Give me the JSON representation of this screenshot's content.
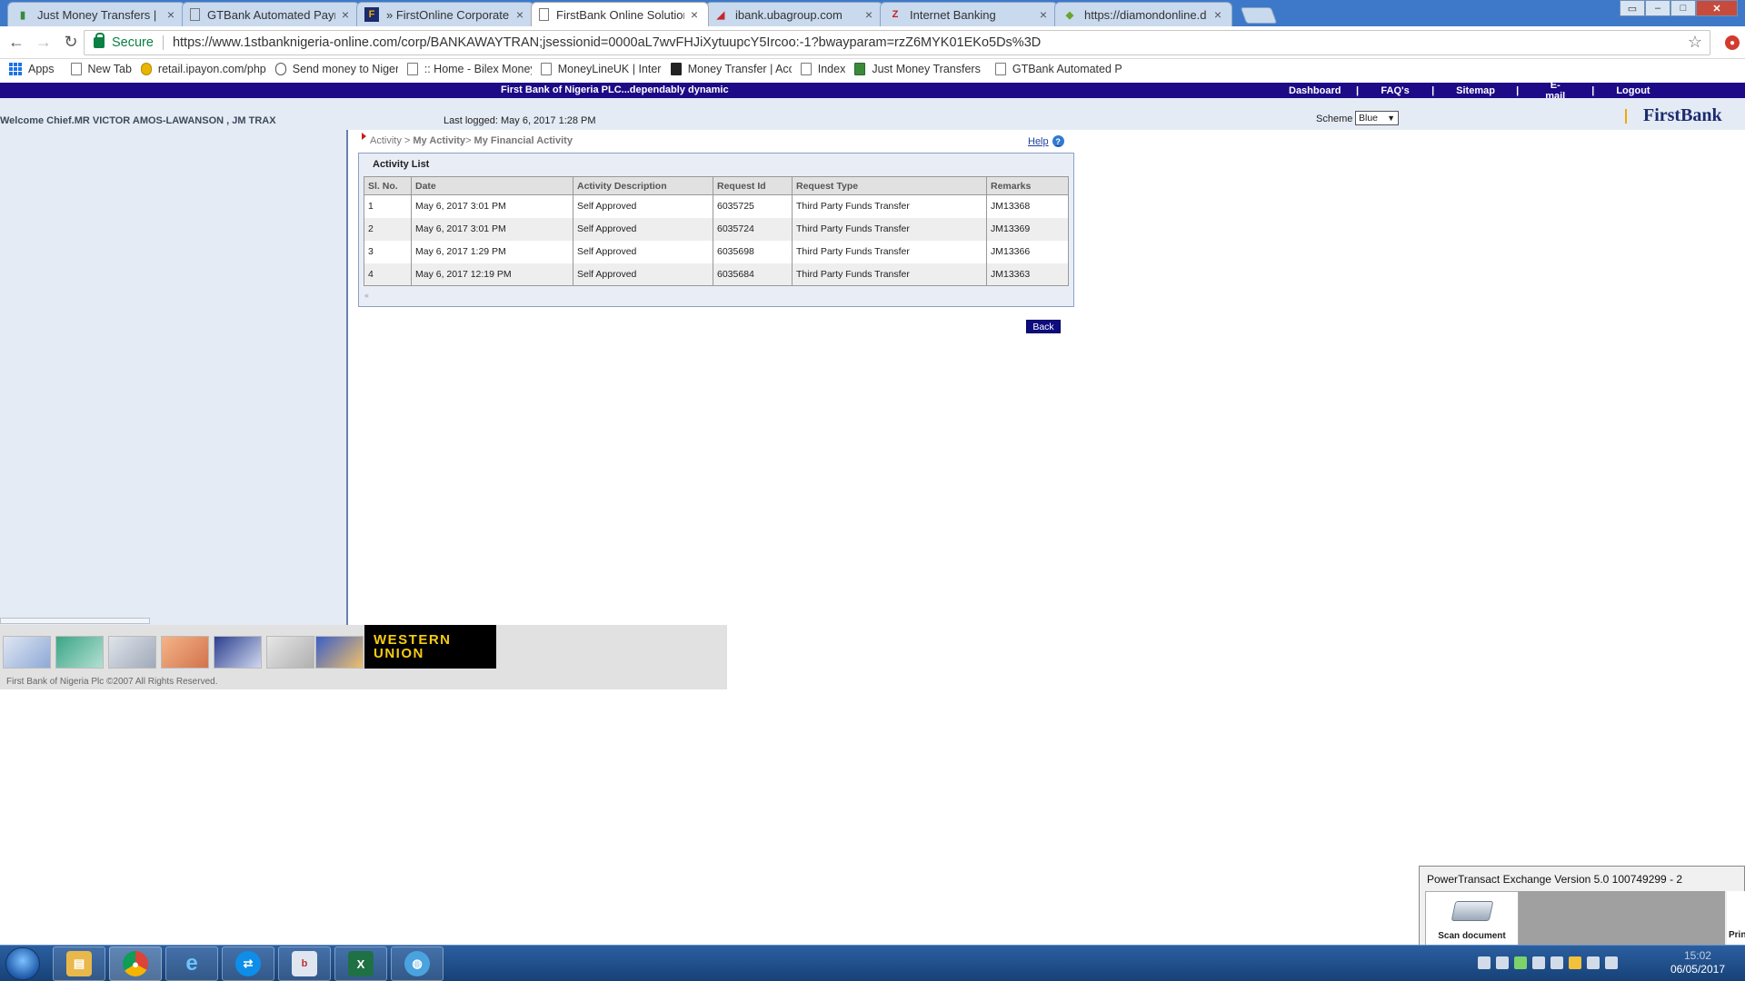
{
  "browser": {
    "tabs": [
      {
        "title": "Just Money Transfers |",
        "favicon": "bank-chart-icon",
        "active": false
      },
      {
        "title": "GTBank Automated Paym",
        "favicon": "page-icon",
        "active": false
      },
      {
        "title": "» FirstOnline Corporate",
        "favicon": "firstbank-icon",
        "active": false
      },
      {
        "title": "FirstBank Online Solution",
        "favicon": "page-icon",
        "active": true
      },
      {
        "title": "ibank.ubagroup.com",
        "favicon": "uba-icon",
        "active": false
      },
      {
        "title": "Internet Banking",
        "favicon": "z-icon",
        "active": false
      },
      {
        "title": "https://diamondonline.d",
        "favicon": "diamond-icon",
        "active": false
      }
    ],
    "tab_close_glyph": "×",
    "secure_label": "Secure",
    "url": "https://www.1stbanknigeria-online.com/corp/BANKAWAYTRAN;jsessionid=0000aL7wvFHJiXytuupcY5Ircoo:-1?bwayparam=rzZ6MYK01EKo5Ds%3D",
    "bookmarks": [
      {
        "label": "Apps",
        "icon": "apps-grid-icon"
      },
      {
        "label": "New Tab",
        "icon": "page-icon"
      },
      {
        "label": "retail.ipayon.com/php",
        "icon": "ipayon-icon"
      },
      {
        "label": "Send money to Nigeri",
        "icon": "loading-icon"
      },
      {
        "label": ":: Home - Bilex Money",
        "icon": "page-icon"
      },
      {
        "label": "MoneyLineUK | Intern",
        "icon": "page-icon"
      },
      {
        "label": "Money Transfer | Accu",
        "icon": "black-square-icon"
      },
      {
        "label": "Index",
        "icon": "page-icon"
      },
      {
        "label": "Just Money Transfers",
        "icon": "bank-chart-icon"
      },
      {
        "label": "GTBank Automated P",
        "icon": "page-icon"
      }
    ]
  },
  "bank": {
    "tagline": "First Bank of Nigeria PLC...dependably dynamic",
    "menu": [
      "Dashboard",
      "FAQ's",
      "Sitemap",
      "E-mail",
      "Logout"
    ],
    "menu_divider": "|",
    "welcome": "Welcome Chief.MR VICTOR AMOS-LAWANSON , JM TRAX",
    "last_logged": "Last logged: May 6, 2017 1:28 PM",
    "scheme_label": "Scheme",
    "scheme_value": "Blue",
    "brand_name": "FirstBank",
    "breadcrumb": {
      "root": "Activity",
      "sep1": " > ",
      "section": "My Activity",
      "sep2": "> ",
      "current": "My Financial Activity"
    },
    "help_label": "Help",
    "activity_title": "Activity List",
    "columns": [
      "Sl. No.",
      "Date",
      "Activity Description",
      "Request Id",
      "Request Type",
      "Remarks"
    ],
    "rows": [
      {
        "sl": "1",
        "date": "May 6, 2017 3:01 PM",
        "desc": "Self Approved",
        "request_id": "6035725",
        "request_type": "Third Party Funds Transfer",
        "remarks": "JM13368"
      },
      {
        "sl": "2",
        "date": "May 6, 2017 3:01 PM",
        "desc": "Self Approved",
        "request_id": "6035724",
        "request_type": "Third Party Funds Transfer",
        "remarks": "JM13369"
      },
      {
        "sl": "3",
        "date": "May 6, 2017 1:29 PM",
        "desc": "Self Approved",
        "request_id": "6035698",
        "request_type": "Third Party Funds Transfer",
        "remarks": "JM13366"
      },
      {
        "sl": "4",
        "date": "May 6, 2017 12:19 PM",
        "desc": "Self Approved",
        "request_id": "6035684",
        "request_type": "Third Party Funds Transfer",
        "remarks": "JM13363"
      }
    ],
    "back_label": "Back",
    "western_union_line1": "WESTERN",
    "western_union_line2": "UNION",
    "copyright": "First Bank of Nigeria Plc ©2007 All Rights Reserved."
  },
  "popup": {
    "title": "PowerTransact Exchange Version 5.0 100749299 - 2",
    "scan_label": "Scan document",
    "print_label": "Print"
  },
  "taskbar": {
    "apps": [
      "explorer-icon",
      "chrome-icon",
      "internet-explorer-icon",
      "teamviewer-icon",
      "bitsa-icon",
      "excel-icon",
      "network-globe-icon"
    ],
    "time": "15:02",
    "date": "06/05/2017"
  },
  "colors": {
    "bank_navy": "#1c0a86",
    "panel_blue": "#e4ebf5",
    "back_button": "#0c0c7e",
    "secure_green": "#0b8043"
  }
}
